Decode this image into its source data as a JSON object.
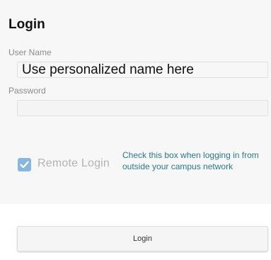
{
  "form": {
    "title": "Login",
    "username_label": "User Name",
    "username_value": "Use personalized name here",
    "password_label": "Password",
    "password_value": "",
    "remote_login_label": "Remote Login",
    "remote_login_checked": true,
    "remote_login_hint": "Check this box when logging in from outside your campus network",
    "login_button_label": "Login"
  },
  "colors": {
    "hint_text": "#2b7a88",
    "checkbox_fill": "#88b6df",
    "remote_label_text": "#b3b3b3"
  },
  "icons": {
    "checkbox": "checkmark-icon"
  }
}
